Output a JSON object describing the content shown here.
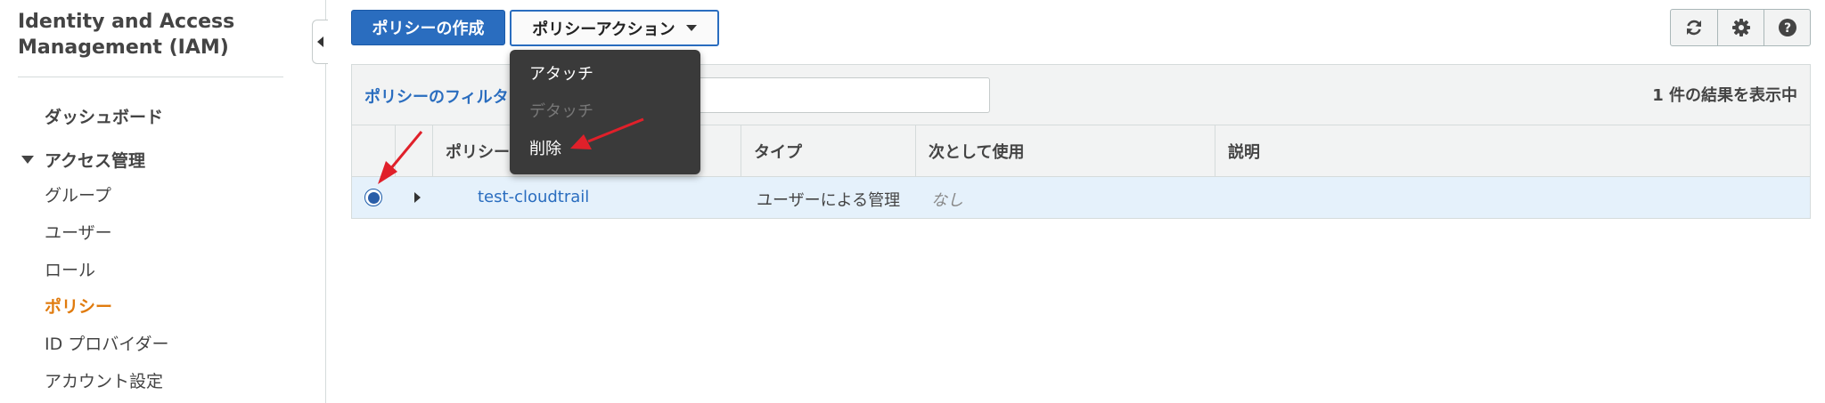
{
  "sidebar": {
    "title": "Identity and Access Management (IAM)",
    "dashboard": "ダッシュボード",
    "section": "アクセス管理",
    "items": {
      "groups": "グループ",
      "users": "ユーザー",
      "roles": "ロール",
      "policies": "ポリシー",
      "idp": "ID プロバイダー",
      "account": "アカウント設定"
    },
    "active_item": "ポリシー"
  },
  "toolbar": {
    "create_label": "ポリシーの作成",
    "actions_label": "ポリシーアクション",
    "icons": [
      "refresh-icon",
      "gear-icon",
      "help-icon"
    ]
  },
  "actions_menu": {
    "items": [
      {
        "label": "アタッチ",
        "enabled": true
      },
      {
        "label": "デタッチ",
        "enabled": false
      },
      {
        "label": "削除",
        "enabled": true
      }
    ]
  },
  "filter": {
    "label": "ポリシーのフィルタ",
    "result_count": "1 件の結果を表示中"
  },
  "table": {
    "columns": [
      "ポリシー名",
      "タイプ",
      "次として使用",
      "説明"
    ],
    "rows": [
      {
        "name": "test-cloudtrail",
        "type": "ユーザーによる管理",
        "used_as": "なし",
        "description": "",
        "selected": true
      }
    ]
  },
  "colors": {
    "primary": "#2a6dbf",
    "active_nav": "#e07b0e",
    "selected_row": "#e5f1fb",
    "menu_bg": "#3a3a3a",
    "annotation_arrow": "#e0202a"
  }
}
